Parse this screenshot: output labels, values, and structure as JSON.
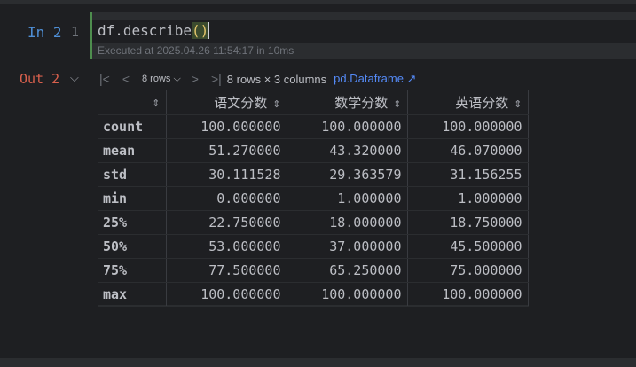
{
  "input_cell": {
    "label": "In 2",
    "line_number": "1",
    "code_prefix": "df.describe",
    "code_parens": "()",
    "exec_info": "Executed at 2025.04.26 11:54:17 in 10ms"
  },
  "output_cell": {
    "label": "Out 2",
    "toolbar": {
      "rows_select": "8 rows ⌵",
      "dimensions": "8 rows × 3 columns",
      "type_link": "pd.Dataframe ↗"
    },
    "table": {
      "columns": [
        "语文分数",
        "数学分数",
        "英语分数"
      ],
      "rows": [
        {
          "index": "count",
          "values": [
            "100.000000",
            "100.000000",
            "100.000000"
          ]
        },
        {
          "index": "mean",
          "values": [
            "51.270000",
            "43.320000",
            "46.070000"
          ]
        },
        {
          "index": "std",
          "values": [
            "30.111528",
            "29.363579",
            "31.156255"
          ]
        },
        {
          "index": "min",
          "values": [
            "0.000000",
            "1.000000",
            "1.000000"
          ]
        },
        {
          "index": "25%",
          "values": [
            "22.750000",
            "18.000000",
            "18.750000"
          ]
        },
        {
          "index": "50%",
          "values": [
            "53.000000",
            "37.000000",
            "45.500000"
          ]
        },
        {
          "index": "75%",
          "values": [
            "77.500000",
            "65.250000",
            "75.000000"
          ]
        },
        {
          "index": "max",
          "values": [
            "100.000000",
            "100.000000",
            "100.000000"
          ]
        }
      ]
    }
  },
  "icons": {
    "first_page": "first-page-icon",
    "prev_page": "prev-page-icon",
    "next_page": "next-page-icon",
    "last_page": "last-page-icon",
    "sort": "sort-icon",
    "collapse": "chevron-down-icon"
  },
  "colors": {
    "background": "#1e1f22",
    "in_label": "#4f8fd6",
    "out_label": "#d9604d",
    "link": "#548af7",
    "cell_marker": "#4e8e4e"
  }
}
